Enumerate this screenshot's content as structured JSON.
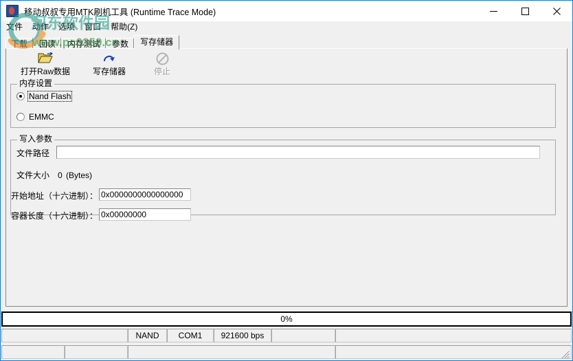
{
  "window": {
    "title": "移动叔叔专用MTK刷机工具 (Runtime Trace Mode)",
    "icon": "app-icon",
    "minimize_label": "minimize-icon",
    "maximize_label": "maximize-icon",
    "close_label": "close-icon",
    "border_color": "#0a7bd4"
  },
  "menubar": {
    "items": [
      {
        "label": "文件"
      },
      {
        "label": "动作"
      },
      {
        "label": "选项"
      },
      {
        "label": "窗口"
      },
      {
        "label": "帮助(Z)"
      }
    ]
  },
  "tabs": {
    "items": [
      {
        "label": "下载",
        "selected": false
      },
      {
        "label": "回读",
        "selected": false
      },
      {
        "label": "内存测试",
        "selected": false
      },
      {
        "label": "参数",
        "selected": false
      },
      {
        "label": "写存储器",
        "selected": true
      }
    ]
  },
  "toolbar": {
    "buttons": [
      {
        "label": "打开Raw数据",
        "icon": "open-folder-icon",
        "disabled": false
      },
      {
        "label": "写存储器",
        "icon": "write-arrow-icon",
        "disabled": false
      },
      {
        "label": "停止",
        "icon": "stop-icon",
        "disabled": true
      }
    ]
  },
  "memory_settings": {
    "title": "内存设置",
    "options": [
      {
        "label": "Nand Flash",
        "checked": true,
        "focused": true
      },
      {
        "label": "EMMC",
        "checked": false,
        "focused": false
      }
    ]
  },
  "write_params": {
    "title": "写入参数",
    "file_path": {
      "label": "文件路径",
      "value": "",
      "placeholder": ""
    },
    "file_size": {
      "label": "文件大小",
      "value": "0",
      "unit": "(Bytes)"
    },
    "start_address": {
      "label": "开始地址（十六进制）：",
      "value": "0x0000000000000000"
    },
    "container_length": {
      "label": "容器长度（十六进制）：",
      "value": "0x00000000"
    }
  },
  "progress": {
    "percent_label": "0%",
    "percent": 0
  },
  "statusbar": {
    "row1": [
      {
        "text": ""
      },
      {
        "text": "NAND"
      },
      {
        "text": "COM1"
      },
      {
        "text": "921600 bps"
      },
      {
        "text": ""
      },
      {
        "text": ""
      }
    ],
    "row2": [
      {
        "text": ""
      },
      {
        "text": ""
      },
      {
        "text": ""
      },
      {
        "text": ""
      }
    ],
    "resize_grip": "resize-grip-icon"
  },
  "watermark": {
    "site_name": "河东软件园",
    "site_url": "www.pc0359.cn",
    "logo": "circle-swoosh-logo",
    "colors": {
      "green": "#3aa35a",
      "teal": "#2e9e8f",
      "orange": "#f08a1c"
    }
  }
}
